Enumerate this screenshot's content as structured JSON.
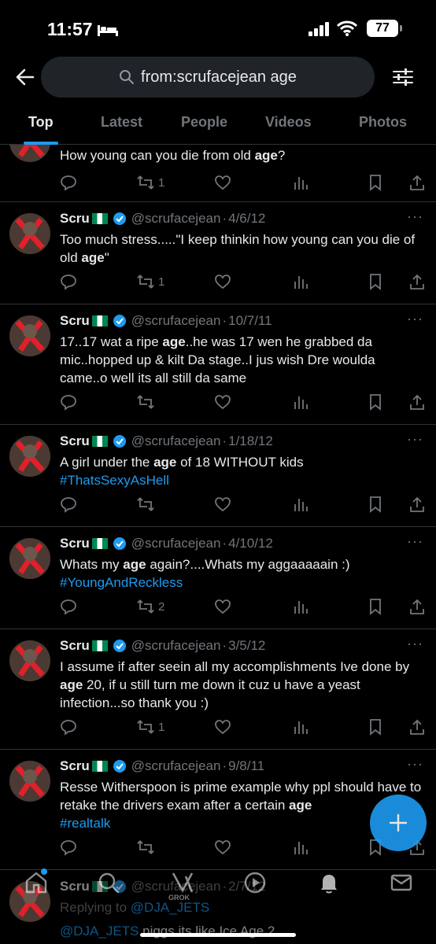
{
  "status_bar": {
    "time": "11:57",
    "battery": "77",
    "icons": [
      "bed-icon",
      "cellular-signal-icon",
      "wifi-icon",
      "battery-icon"
    ]
  },
  "header": {
    "search_query": "from:scrufacejean age",
    "icons": [
      "back-arrow-icon",
      "search-icon",
      "filter-sliders-icon"
    ]
  },
  "tabs": [
    {
      "label": "Top",
      "active": true
    },
    {
      "label": "Latest",
      "active": false
    },
    {
      "label": "People",
      "active": false
    },
    {
      "label": "Videos",
      "active": false
    },
    {
      "label": "Photos",
      "active": false
    }
  ],
  "tweets": [
    {
      "name": "",
      "handle": "",
      "date": "",
      "text_before": "How young can you die from old ",
      "keyword": "age",
      "text_after": "?",
      "hashtag": "",
      "retweets": "1"
    },
    {
      "name": "Scru",
      "handle": "@scrufacejean",
      "date": "4/6/12",
      "text_before": "Too much stress.....\"I keep thinkin how young can you die of old ",
      "keyword": "age",
      "text_after": "\"",
      "hashtag": "",
      "retweets": "1"
    },
    {
      "name": "Scru",
      "handle": "@scrufacejean",
      "date": "10/7/11",
      "text_before": "17..17 wat a ripe ",
      "keyword": "age",
      "text_after": "..he was 17 wen he grabbed da mic..hopped up & kilt Da stage..I jus wish Dre woulda came..o well its all still da same",
      "hashtag": "",
      "retweets": ""
    },
    {
      "name": "Scru",
      "handle": "@scrufacejean",
      "date": "1/18/12",
      "text_before": "A girl under the ",
      "keyword": "age",
      "text_after": " of 18 WITHOUT kids",
      "hashtag": "#ThatsSexyAsHell",
      "retweets": ""
    },
    {
      "name": "Scru",
      "handle": "@scrufacejean",
      "date": "4/10/12",
      "text_before": "Whats my ",
      "keyword": "age",
      "text_after": " again?....Whats my aggaaaaain :)",
      "hashtag": "#YoungAndReckless",
      "retweets": "2"
    },
    {
      "name": "Scru",
      "handle": "@scrufacejean",
      "date": "3/5/12",
      "text_before": "I assume if after seein all my accomplishments Ive done by ",
      "keyword": "age",
      "text_after": " 20, if u still turn me down it cuz u have a yeast infection...so thank you :)",
      "hashtag": "",
      "retweets": "1"
    },
    {
      "name": "Scru",
      "handle": "@scrufacejean",
      "date": "9/8/11",
      "text_before": "Resse Witherspoon is prime example why ppl should have to retake the drivers exam after a certain ",
      "keyword": "age",
      "text_after": "",
      "hashtag": "#realtalk",
      "retweets": ""
    },
    {
      "name": "Scru",
      "handle": "@scrufacejean",
      "date": "2/7/12",
      "replying_to_label": "Replying to",
      "replying_to_handle": "@DJA_JETS",
      "text_before": "",
      "keyword": "",
      "text_after": "niggs its like Ice Age 2",
      "mention": "@DJA_JETS",
      "hashtag": "",
      "retweets": ""
    }
  ],
  "bottom_nav": {
    "grok_label": "GROK",
    "icons": [
      "home-icon",
      "search-icon",
      "grok-icon",
      "play-icon",
      "bell-icon",
      "mail-icon"
    ]
  },
  "fab": {
    "icon": "plus-icon"
  },
  "colors": {
    "accent": "#1d9bf0",
    "background": "#000000",
    "muted": "#71767b",
    "flag_green": "#008751"
  }
}
